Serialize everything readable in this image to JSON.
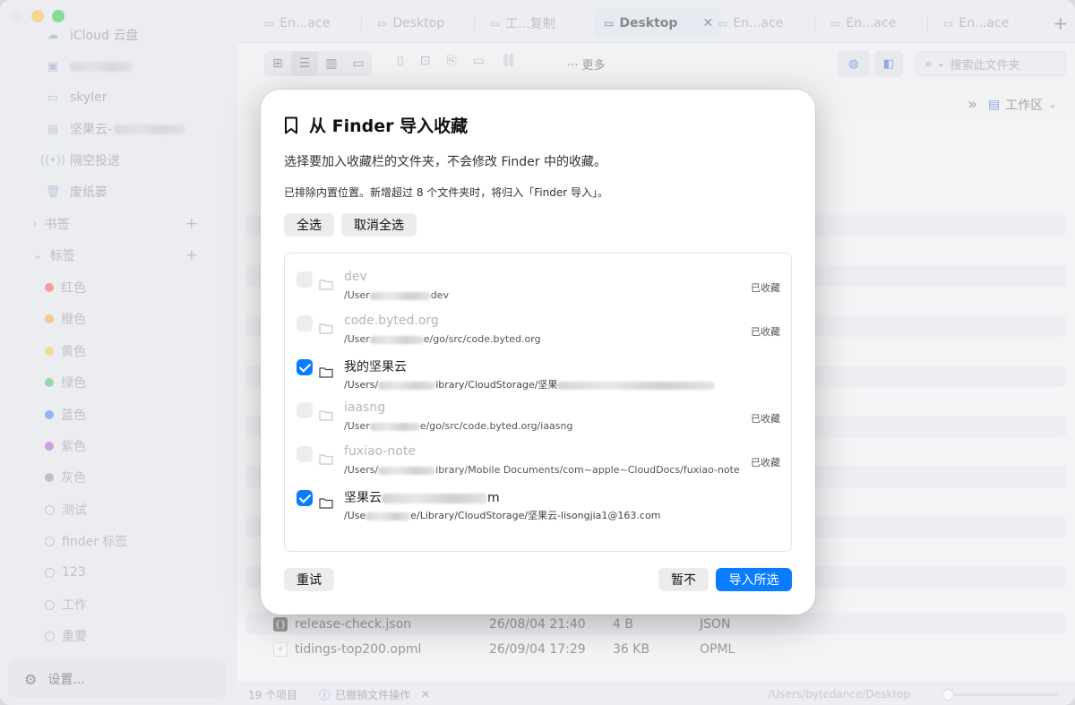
{
  "sidebar": {
    "items": [
      {
        "label": "iCloud 云盘",
        "icon": "cloud-icon"
      },
      {
        "label": "",
        "icon": "computer-icon"
      },
      {
        "label": "skyler",
        "icon": "display-icon"
      },
      {
        "label": "坚果云-",
        "icon": "drive-icon"
      },
      {
        "label": "隔空投送",
        "icon": "airdrop-icon"
      },
      {
        "label": "废纸篓",
        "icon": "trash-icon"
      }
    ],
    "bookmarks_label": "书签",
    "tags_label": "标签",
    "tags": [
      {
        "label": "红色",
        "color": "#f05a5a"
      },
      {
        "label": "橙色",
        "color": "#f5a050"
      },
      {
        "label": "黄色",
        "color": "#f2cc40"
      },
      {
        "label": "绿色",
        "color": "#55c267"
      },
      {
        "label": "蓝色",
        "color": "#3f86f0"
      },
      {
        "label": "紫色",
        "color": "#b258d6"
      },
      {
        "label": "灰色",
        "color": "#9a9aa0"
      },
      {
        "label": "测试",
        "color": ""
      },
      {
        "label": "finder 标签",
        "color": ""
      },
      {
        "label": "123",
        "color": ""
      },
      {
        "label": "工作",
        "color": ""
      },
      {
        "label": "重要",
        "color": ""
      }
    ],
    "settings_label": "设置..."
  },
  "tabs": [
    {
      "label": "En...ace"
    },
    {
      "label": "Desktop"
    },
    {
      "label": "工...复制"
    },
    {
      "label": "Desktop",
      "active": true
    },
    {
      "label": "En...ace"
    },
    {
      "label": "En...ace"
    },
    {
      "label": "En...ace"
    }
  ],
  "toolbar": {
    "more_label": "更多",
    "search_placeholder": "搜索此文件夹",
    "workspace_label": "工作区"
  },
  "files": [
    {
      "name": "release-check.json",
      "date": "26/08/04 21:40",
      "size": "4 B",
      "kind": "JSON"
    },
    {
      "name": "tidings-top200.opml",
      "date": "26/09/04 17:29",
      "size": "36 KB",
      "kind": "OPML"
    }
  ],
  "status": {
    "count": "19 个项目",
    "undo_text": "已撤销文件操作",
    "path": "/Users/bytedance/Desktop"
  },
  "dialog": {
    "title": "从 Finder 导入收藏",
    "description": "选择要加入收藏栏的文件夹，不会修改 Finder 中的收藏。",
    "note": "已排除内置位置。新增超过 8 个文件夹时，将归入「Finder 导入」。",
    "select_all": "全选",
    "deselect_all": "取消全选",
    "items": [
      {
        "name": "dev",
        "path_start": "/User",
        "path_end": "dev",
        "checked": false,
        "disabled": true,
        "badge": "已收藏"
      },
      {
        "name": "code.byted.org",
        "path_start": "/User",
        "path_end": "e/go/src/code.byted.org",
        "checked": false,
        "disabled": true,
        "badge": "已收藏"
      },
      {
        "name": "我的坚果云",
        "path_start": "/Users/",
        "path_end": "ibrary/CloudStorage/坚果",
        "checked": true,
        "disabled": false,
        "badge": ""
      },
      {
        "name": "iaasng",
        "path_start": "/User",
        "path_end": "e/go/src/code.byted.org/iaasng",
        "checked": false,
        "disabled": true,
        "badge": "已收藏"
      },
      {
        "name": "fuxiao-note",
        "path_start": "/Users/",
        "path_end": "ibrary/Mobile Documents/com~apple~CloudDocs/fuxiao-note",
        "checked": false,
        "disabled": true,
        "badge": "已收藏"
      },
      {
        "name_start": "坚果云",
        "name_end": "m",
        "path_start": "/Use",
        "path_end": "e/Library/CloudStorage/坚果云-lisongjia1@163.com",
        "checked": true,
        "disabled": false,
        "badge": ""
      }
    ],
    "retry": "重试",
    "later": "暂不",
    "import": "导入所选"
  },
  "colors": {
    "accent": "#0a7cff"
  }
}
